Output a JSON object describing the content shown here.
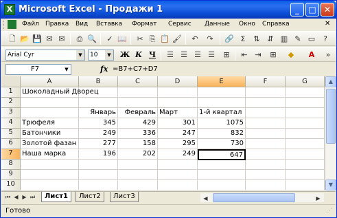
{
  "window": {
    "title": "Microsoft Excel - Продажи 1"
  },
  "menu": [
    "Файл",
    "Правка",
    "Вид",
    "Вставка",
    "Формат",
    "Сервис",
    "Данные",
    "Окно",
    "Справка"
  ],
  "toolbar": {
    "font_name": "Arial Cyr",
    "font_size": "10",
    "bold": "Ж",
    "italic": "К",
    "underline": "Ч",
    "sum": "Σ"
  },
  "formula_bar": {
    "name_box": "F7",
    "fx": "fx",
    "formula": "=B7+C7+D7"
  },
  "grid": {
    "columns": [
      "A",
      "B",
      "C",
      "D",
      "E",
      "F",
      "G"
    ],
    "rows": [
      "1",
      "2",
      "3",
      "4",
      "5",
      "6",
      "7",
      "8",
      "9",
      "10"
    ],
    "title_cell": "Шоколадный Дворец",
    "headers": [
      "Январь",
      "Февраль",
      "Март",
      "1-й квартал"
    ],
    "data": [
      {
        "name": "Трюфеля",
        "jan": "345",
        "feb": "429",
        "mar": "301",
        "total": "1075"
      },
      {
        "name": "Батончики",
        "jan": "249",
        "feb": "336",
        "mar": "247",
        "total": "832"
      },
      {
        "name": "Золотой фазан",
        "jan": "277",
        "feb": "158",
        "mar": "295",
        "total": "730"
      },
      {
        "name": "Наша марка",
        "jan": "196",
        "feb": "202",
        "mar": "249",
        "total": "647"
      }
    ]
  },
  "sheets": [
    "Лист1",
    "Лист2",
    "Лист3"
  ],
  "status": "Готово",
  "colors": {
    "title_bar": "#0a5ee6",
    "selection": "#f9b35a"
  }
}
